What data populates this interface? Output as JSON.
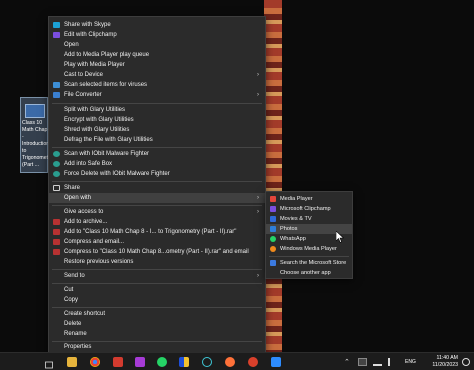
{
  "desktop_file": {
    "name": "Class 10 Math Chap 8 - Introduction to Trigonometry (Part ..."
  },
  "context_menu": {
    "items": [
      {
        "label": "Share with Skype",
        "icon_color": "#1ca1d6"
      },
      {
        "label": "Edit with Clipchamp",
        "icon_color": "#7b4ee0"
      },
      {
        "label": "Open"
      },
      {
        "label": "Add to Media Player play queue"
      },
      {
        "label": "Play with Media Player"
      },
      {
        "label": "Cast to Device"
      },
      {
        "label": "Scan selected items for viruses",
        "icon_color": "#3d8fd6"
      },
      {
        "label": "File Converter",
        "icon_color": "#3a7fd0"
      },
      {
        "label": "Split with Glary Utilities"
      },
      {
        "label": "Encrypt with Glary Utilities"
      },
      {
        "label": "Shred with Glary Utilities"
      },
      {
        "label": "Defrag the File with Glary Utilities"
      },
      {
        "label": "Scan with IObit Malware Fighter",
        "icon_color": "#2a9d8f"
      },
      {
        "label": "Add into Safe Box",
        "icon_color": "#2a9d8f"
      },
      {
        "label": "Force Delete with IObit Malware Fighter",
        "icon_color": "#2a9d8f"
      },
      {
        "label": "Share"
      },
      {
        "label": "Open with"
      },
      {
        "label": "Give access to"
      },
      {
        "label": "Add to archive...",
        "icon_color": "#b83232"
      },
      {
        "label": "Add to \"Class 10 Math Chap 8 - I... to Trigonometry (Part - II).rar\"",
        "icon_color": "#b83232"
      },
      {
        "label": "Compress and email...",
        "icon_color": "#b83232"
      },
      {
        "label": "Compress to \"Class 10 Math Chap 8...ometry (Part - II).rar\" and email",
        "icon_color": "#b83232"
      },
      {
        "label": "Restore previous versions"
      },
      {
        "label": "Send to"
      },
      {
        "label": "Cut"
      },
      {
        "label": "Copy"
      },
      {
        "label": "Create shortcut"
      },
      {
        "label": "Delete"
      },
      {
        "label": "Rename"
      },
      {
        "label": "Properties"
      }
    ]
  },
  "open_with_submenu": {
    "items": [
      {
        "label": "Media Player",
        "icon_color": "#e3463b"
      },
      {
        "label": "Microsoft Clipchamp",
        "icon_color": "#7b4ee0"
      },
      {
        "label": "Movies & TV",
        "icon_color": "#2f6ad9"
      },
      {
        "label": "Photos",
        "icon_color": "#2f7fd9"
      },
      {
        "label": "WhatsApp",
        "icon_color": "#25d366"
      },
      {
        "label": "Windows Media Player",
        "icon_color": "#f08a1c"
      },
      {
        "label": "Search the Microsoft Store",
        "icon_color": "#3b7ae0"
      },
      {
        "label": "Choose another app"
      }
    ]
  },
  "taskbar": {
    "tray": {
      "language": "ENG"
    },
    "clock": {
      "time": "11:40 AM",
      "date": "11/20/2023"
    }
  }
}
